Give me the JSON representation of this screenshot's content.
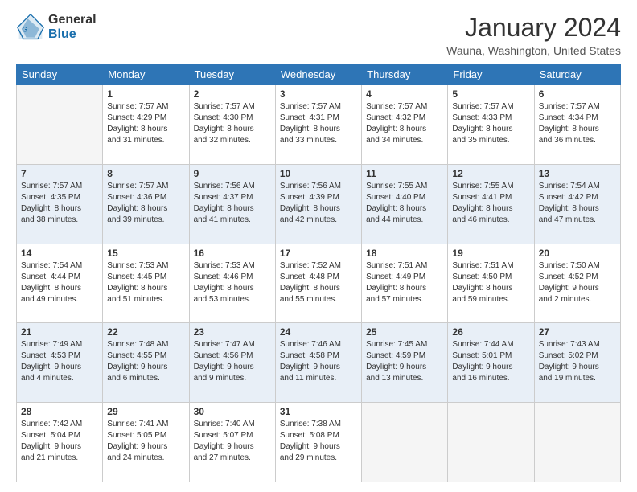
{
  "logo": {
    "general": "General",
    "blue": "Blue"
  },
  "header": {
    "title": "January 2024",
    "location": "Wauna, Washington, United States"
  },
  "weekdays": [
    "Sunday",
    "Monday",
    "Tuesday",
    "Wednesday",
    "Thursday",
    "Friday",
    "Saturday"
  ],
  "weeks": [
    [
      {
        "day": "",
        "sunrise": "",
        "sunset": "",
        "daylight": ""
      },
      {
        "day": "1",
        "sunrise": "Sunrise: 7:57 AM",
        "sunset": "Sunset: 4:29 PM",
        "daylight": "Daylight: 8 hours and 31 minutes."
      },
      {
        "day": "2",
        "sunrise": "Sunrise: 7:57 AM",
        "sunset": "Sunset: 4:30 PM",
        "daylight": "Daylight: 8 hours and 32 minutes."
      },
      {
        "day": "3",
        "sunrise": "Sunrise: 7:57 AM",
        "sunset": "Sunset: 4:31 PM",
        "daylight": "Daylight: 8 hours and 33 minutes."
      },
      {
        "day": "4",
        "sunrise": "Sunrise: 7:57 AM",
        "sunset": "Sunset: 4:32 PM",
        "daylight": "Daylight: 8 hours and 34 minutes."
      },
      {
        "day": "5",
        "sunrise": "Sunrise: 7:57 AM",
        "sunset": "Sunset: 4:33 PM",
        "daylight": "Daylight: 8 hours and 35 minutes."
      },
      {
        "day": "6",
        "sunrise": "Sunrise: 7:57 AM",
        "sunset": "Sunset: 4:34 PM",
        "daylight": "Daylight: 8 hours and 36 minutes."
      }
    ],
    [
      {
        "day": "7",
        "sunrise": "Sunrise: 7:57 AM",
        "sunset": "Sunset: 4:35 PM",
        "daylight": "Daylight: 8 hours and 38 minutes."
      },
      {
        "day": "8",
        "sunrise": "Sunrise: 7:57 AM",
        "sunset": "Sunset: 4:36 PM",
        "daylight": "Daylight: 8 hours and 39 minutes."
      },
      {
        "day": "9",
        "sunrise": "Sunrise: 7:56 AM",
        "sunset": "Sunset: 4:37 PM",
        "daylight": "Daylight: 8 hours and 41 minutes."
      },
      {
        "day": "10",
        "sunrise": "Sunrise: 7:56 AM",
        "sunset": "Sunset: 4:39 PM",
        "daylight": "Daylight: 8 hours and 42 minutes."
      },
      {
        "day": "11",
        "sunrise": "Sunrise: 7:55 AM",
        "sunset": "Sunset: 4:40 PM",
        "daylight": "Daylight: 8 hours and 44 minutes."
      },
      {
        "day": "12",
        "sunrise": "Sunrise: 7:55 AM",
        "sunset": "Sunset: 4:41 PM",
        "daylight": "Daylight: 8 hours and 46 minutes."
      },
      {
        "day": "13",
        "sunrise": "Sunrise: 7:54 AM",
        "sunset": "Sunset: 4:42 PM",
        "daylight": "Daylight: 8 hours and 47 minutes."
      }
    ],
    [
      {
        "day": "14",
        "sunrise": "Sunrise: 7:54 AM",
        "sunset": "Sunset: 4:44 PM",
        "daylight": "Daylight: 8 hours and 49 minutes."
      },
      {
        "day": "15",
        "sunrise": "Sunrise: 7:53 AM",
        "sunset": "Sunset: 4:45 PM",
        "daylight": "Daylight: 8 hours and 51 minutes."
      },
      {
        "day": "16",
        "sunrise": "Sunrise: 7:53 AM",
        "sunset": "Sunset: 4:46 PM",
        "daylight": "Daylight: 8 hours and 53 minutes."
      },
      {
        "day": "17",
        "sunrise": "Sunrise: 7:52 AM",
        "sunset": "Sunset: 4:48 PM",
        "daylight": "Daylight: 8 hours and 55 minutes."
      },
      {
        "day": "18",
        "sunrise": "Sunrise: 7:51 AM",
        "sunset": "Sunset: 4:49 PM",
        "daylight": "Daylight: 8 hours and 57 minutes."
      },
      {
        "day": "19",
        "sunrise": "Sunrise: 7:51 AM",
        "sunset": "Sunset: 4:50 PM",
        "daylight": "Daylight: 8 hours and 59 minutes."
      },
      {
        "day": "20",
        "sunrise": "Sunrise: 7:50 AM",
        "sunset": "Sunset: 4:52 PM",
        "daylight": "Daylight: 9 hours and 2 minutes."
      }
    ],
    [
      {
        "day": "21",
        "sunrise": "Sunrise: 7:49 AM",
        "sunset": "Sunset: 4:53 PM",
        "daylight": "Daylight: 9 hours and 4 minutes."
      },
      {
        "day": "22",
        "sunrise": "Sunrise: 7:48 AM",
        "sunset": "Sunset: 4:55 PM",
        "daylight": "Daylight: 9 hours and 6 minutes."
      },
      {
        "day": "23",
        "sunrise": "Sunrise: 7:47 AM",
        "sunset": "Sunset: 4:56 PM",
        "daylight": "Daylight: 9 hours and 9 minutes."
      },
      {
        "day": "24",
        "sunrise": "Sunrise: 7:46 AM",
        "sunset": "Sunset: 4:58 PM",
        "daylight": "Daylight: 9 hours and 11 minutes."
      },
      {
        "day": "25",
        "sunrise": "Sunrise: 7:45 AM",
        "sunset": "Sunset: 4:59 PM",
        "daylight": "Daylight: 9 hours and 13 minutes."
      },
      {
        "day": "26",
        "sunrise": "Sunrise: 7:44 AM",
        "sunset": "Sunset: 5:01 PM",
        "daylight": "Daylight: 9 hours and 16 minutes."
      },
      {
        "day": "27",
        "sunrise": "Sunrise: 7:43 AM",
        "sunset": "Sunset: 5:02 PM",
        "daylight": "Daylight: 9 hours and 19 minutes."
      }
    ],
    [
      {
        "day": "28",
        "sunrise": "Sunrise: 7:42 AM",
        "sunset": "Sunset: 5:04 PM",
        "daylight": "Daylight: 9 hours and 21 minutes."
      },
      {
        "day": "29",
        "sunrise": "Sunrise: 7:41 AM",
        "sunset": "Sunset: 5:05 PM",
        "daylight": "Daylight: 9 hours and 24 minutes."
      },
      {
        "day": "30",
        "sunrise": "Sunrise: 7:40 AM",
        "sunset": "Sunset: 5:07 PM",
        "daylight": "Daylight: 9 hours and 27 minutes."
      },
      {
        "day": "31",
        "sunrise": "Sunrise: 7:38 AM",
        "sunset": "Sunset: 5:08 PM",
        "daylight": "Daylight: 9 hours and 29 minutes."
      },
      {
        "day": "",
        "sunrise": "",
        "sunset": "",
        "daylight": ""
      },
      {
        "day": "",
        "sunrise": "",
        "sunset": "",
        "daylight": ""
      },
      {
        "day": "",
        "sunrise": "",
        "sunset": "",
        "daylight": ""
      }
    ]
  ]
}
